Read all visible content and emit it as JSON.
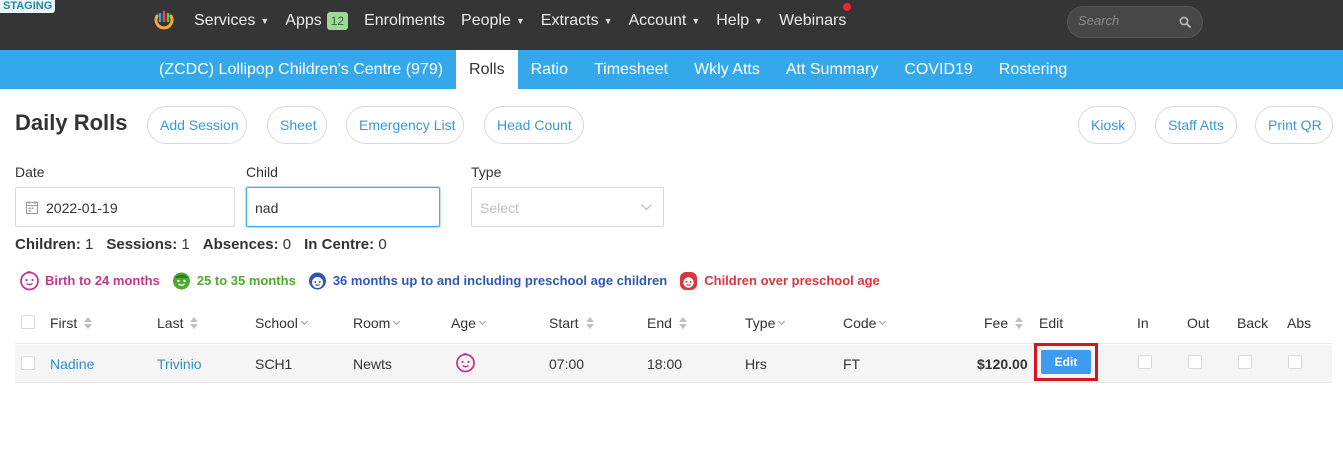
{
  "env_badge": "STAGING",
  "topnav": {
    "items": [
      {
        "label": "Services",
        "caret": true
      },
      {
        "label": "Apps",
        "badge": "12"
      },
      {
        "label": "Enrolments"
      },
      {
        "label": "People",
        "caret": true
      },
      {
        "label": "Extracts",
        "caret": true
      },
      {
        "label": "Account",
        "caret": true
      },
      {
        "label": "Help",
        "caret": true
      },
      {
        "label": "Webinars"
      }
    ],
    "search_placeholder": "Search"
  },
  "subnav": {
    "items": [
      "(ZCDC) Lollipop Children's Centre (979)",
      "Rolls",
      "Ratio",
      "Timesheet",
      "Wkly Atts",
      "Att Summary",
      "COVID19",
      "Rostering"
    ],
    "active": "Rolls"
  },
  "page": {
    "title": "Daily Rolls",
    "actions_left": [
      "Add Session",
      "Sheet",
      "Emergency List",
      "Head Count"
    ],
    "actions_right": [
      "Kiosk",
      "Staff Atts",
      "Print QR"
    ]
  },
  "filters": {
    "date_label": "Date",
    "date_value": "2022-01-19",
    "child_label": "Child",
    "child_value": "nad",
    "type_label": "Type",
    "type_placeholder": "Select"
  },
  "summary": {
    "children_label": "Children:",
    "children": "1",
    "sessions_label": "Sessions:",
    "sessions": "1",
    "absences_label": "Absences:",
    "absences": "0",
    "in_centre_label": "In Centre:",
    "in_centre": "0"
  },
  "legend": [
    {
      "label": "Birth to 24 months",
      "color": "#c0398c"
    },
    {
      "label": "25 to 35 months",
      "color": "#4caa2e"
    },
    {
      "label": "36 months up to and including preschool age children",
      "color": "#2f57b5"
    },
    {
      "label": "Children over preschool age",
      "color": "#d9363e"
    }
  ],
  "table": {
    "headers": {
      "first": "First",
      "last": "Last",
      "school": "School",
      "room": "Room",
      "age": "Age",
      "start": "Start",
      "end": "End",
      "type": "Type",
      "code": "Code",
      "fee": "Fee",
      "edit": "Edit",
      "in": "In",
      "out": "Out",
      "back": "Back",
      "abs": "Abs"
    },
    "rows": [
      {
        "first": "Nadine",
        "last": "Trivinio",
        "school": "SCH1",
        "room": "Newts",
        "age_icon": "infant-face-icon",
        "start": "07:00",
        "end": "18:00",
        "type": "Hrs",
        "code": "FT",
        "fee": "$120.00",
        "edit_label": "Edit"
      }
    ]
  },
  "colors": {
    "topbar": "#353535",
    "subnav": "#35a7eb",
    "link": "#2f8fd3",
    "highlight": "#d4141f"
  }
}
